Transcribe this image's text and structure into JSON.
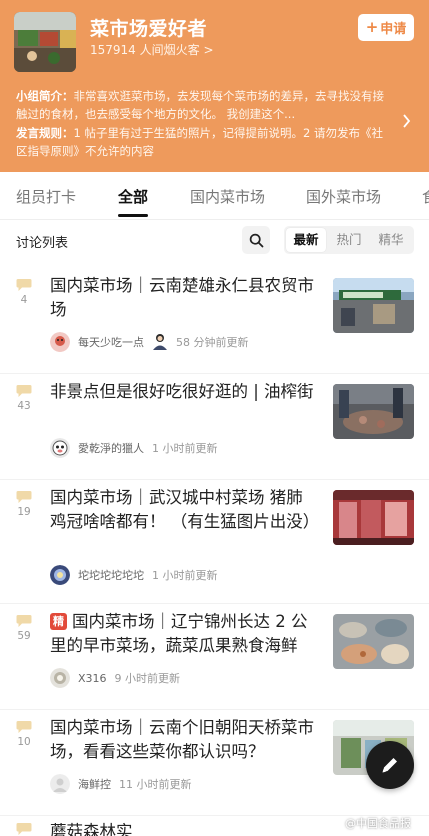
{
  "group": {
    "title": "菜市场爱好者",
    "members": "157914 人间烟火客 >",
    "apply_label": "申请",
    "intro_label": "小组简介：",
    "intro_text": "非常喜欢逛菜市场，去发现每个菜市场的差异，去寻找没有接触过的食材，也去感受每个地方的文化。 我创建这个...",
    "rules_label": "发言规则：",
    "rules_text": "1 帖子里有过于生猛的照片，记得提前说明。2 请勿发布《社区指导原则》不允许的内容"
  },
  "tabs": [
    "组员打卡",
    "全部",
    "国内菜市场",
    "国外菜市场",
    "食"
  ],
  "active_tab": "全部",
  "discussion": {
    "title": "讨论列表",
    "sort": [
      "最新",
      "热门",
      "精华"
    ],
    "active_sort": "最新"
  },
  "posts": [
    {
      "count": "4",
      "title": "国内菜市场｜云南楚雄永仁县农贸市场",
      "author": "每天少吃一点",
      "time": "58 分钟前更新",
      "badge": ""
    },
    {
      "count": "43",
      "title": "非景点但是很好吃很好逛的 | 油榨街",
      "author": "愛乾淨的獵人",
      "time": "1 小时前更新",
      "badge": ""
    },
    {
      "count": "19",
      "title": "国内菜市场｜武汉城中村菜场 猪肺鸡冠啥啥都有！ （有生猛图片出没）",
      "author": "坨坨坨坨坨坨",
      "time": "1 小时前更新",
      "badge": ""
    },
    {
      "count": "59",
      "title": "国内菜市场｜辽宁锦州长达 2 公里的早市菜场，蔬菜瓜果熟食海鲜",
      "author": "X316",
      "time": "9 小时前更新",
      "badge": "精"
    },
    {
      "count": "10",
      "title": "国内菜市场｜云南个旧朝阳天桥菜市场，看看这些菜你都认识吗？",
      "author": "海鲜控",
      "time": "11 小时前更新",
      "badge": ""
    }
  ],
  "partial_post_title": "蘑菇森林实",
  "watermark": "@中国食品报",
  "colors": {
    "header_bg": "#ee9a5c",
    "badge": "#e24a3a",
    "bubble": "#f0d9a8"
  }
}
